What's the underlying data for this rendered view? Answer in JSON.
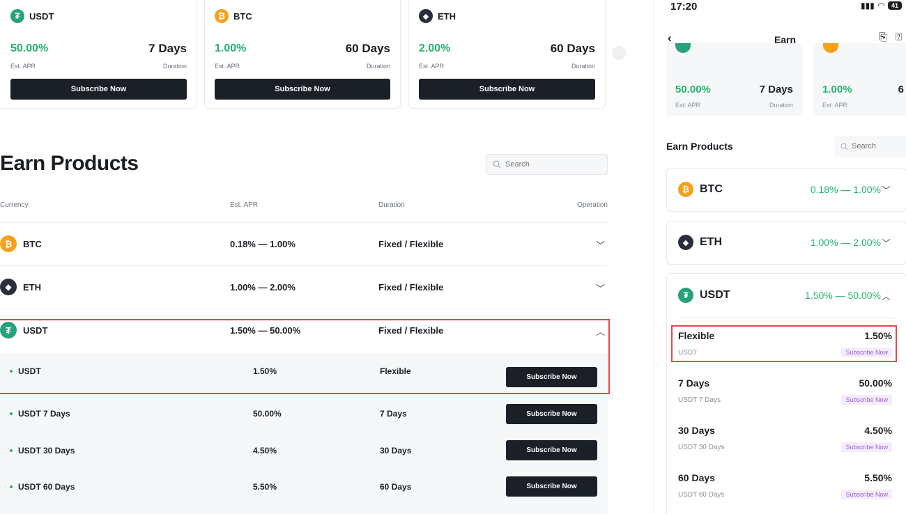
{
  "desktop": {
    "cards": [
      {
        "coin": "USDT",
        "apr": "50.00%",
        "duration": "7 Days",
        "apr_label": "Est. APR",
        "duration_label": "Duration",
        "button": "Subscribe Now"
      },
      {
        "coin": "BTC",
        "apr": "1.00%",
        "duration": "60 Days",
        "apr_label": "Est. APR",
        "duration_label": "Duration",
        "button": "Subscribe Now"
      },
      {
        "coin": "ETH",
        "apr": "2.00%",
        "duration": "60 Days",
        "apr_label": "Est. APR",
        "duration_label": "Duration",
        "button": "Subscribe Now"
      }
    ],
    "section_title": "Earn Products",
    "search_placeholder": "Search",
    "table_headers": {
      "currency": "Currency",
      "apr": "Est. APR",
      "duration": "Duration",
      "operation": "Operation"
    },
    "rows": [
      {
        "coin": "BTC",
        "apr": "0.18% — 1.00%",
        "duration": "Fixed / Flexible"
      },
      {
        "coin": "ETH",
        "apr": "1.00% — 2.00%",
        "duration": "Fixed / Flexible"
      },
      {
        "coin": "USDT",
        "apr": "1.50% — 50.00%",
        "duration": "Fixed / Flexible"
      }
    ],
    "usdt_products": [
      {
        "name": "USDT",
        "apr": "1.50%",
        "duration": "Flexible",
        "button": "Subscribe Now"
      },
      {
        "name": "USDT 7 Days",
        "apr": "50.00%",
        "duration": "7 Days",
        "button": "Subscribe Now"
      },
      {
        "name": "USDT 30 Days",
        "apr": "4.50%",
        "duration": "30 Days",
        "button": "Subscribe Now"
      },
      {
        "name": "USDT 60 Days",
        "apr": "5.50%",
        "duration": "60 Days",
        "button": "Subscribe Now"
      }
    ]
  },
  "mobile": {
    "status": {
      "time": "17:20",
      "battery": "41"
    },
    "title": "Earn",
    "cards": [
      {
        "apr": "50.00%",
        "duration": "7 Days",
        "apr_label": "Est. APR",
        "duration_label": "Duration"
      },
      {
        "apr": "1.00%",
        "duration": "6",
        "apr_label": "Est. APR"
      }
    ],
    "section_title": "Earn Products",
    "search_placeholder": "Search",
    "rows": [
      {
        "coin": "BTC",
        "range": "0.18% — 1.00%"
      },
      {
        "coin": "ETH",
        "range": "1.00% — 2.00%"
      }
    ],
    "usdt": {
      "coin": "USDT",
      "range": "1.50% — 50.00%",
      "products": [
        {
          "title": "Flexible",
          "apr": "1.50%",
          "sub": "USDT",
          "button": "Subscribe Now"
        },
        {
          "title": "7 Days",
          "apr": "50.00%",
          "sub": "USDT 7 Days",
          "button": "Subscribe Now"
        },
        {
          "title": "30 Days",
          "apr": "4.50%",
          "sub": "USDT 30 Days",
          "button": "Subscribe Now"
        },
        {
          "title": "60 Days",
          "apr": "5.50%",
          "sub": "USDT 60 Days",
          "button": "Subscribe Now"
        }
      ]
    }
  },
  "colors": {
    "accent_green": "#23b26d",
    "button_dark": "#1b1f26",
    "highlight": "#e5484d",
    "usdt": "#26a17b",
    "btc": "#f7a01b",
    "eth": "#2a2d3a",
    "mobile_button_text": "#9b5fd6"
  }
}
